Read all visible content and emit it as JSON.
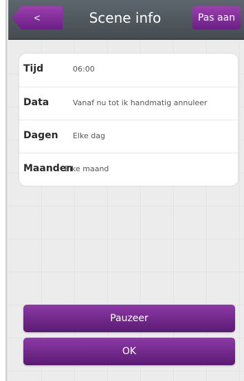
{
  "header": {
    "back_label": "<",
    "title": "Scene info",
    "edit_label": "Pas aan"
  },
  "info": {
    "rows": [
      {
        "label": "Tijd",
        "value": "06:00"
      },
      {
        "label": "Data",
        "value": "Vanaf nu tot ik handmatig annuleer"
      },
      {
        "label": "Dagen",
        "value": "Elke dag"
      },
      {
        "label": "Maanden",
        "value": "Elke maand"
      }
    ]
  },
  "actions": {
    "pause_label": "Pauzeer",
    "ok_label": "OK"
  },
  "colors": {
    "accent": "#7a2a93",
    "header_bg": "#4f575d",
    "background": "#ececec"
  }
}
